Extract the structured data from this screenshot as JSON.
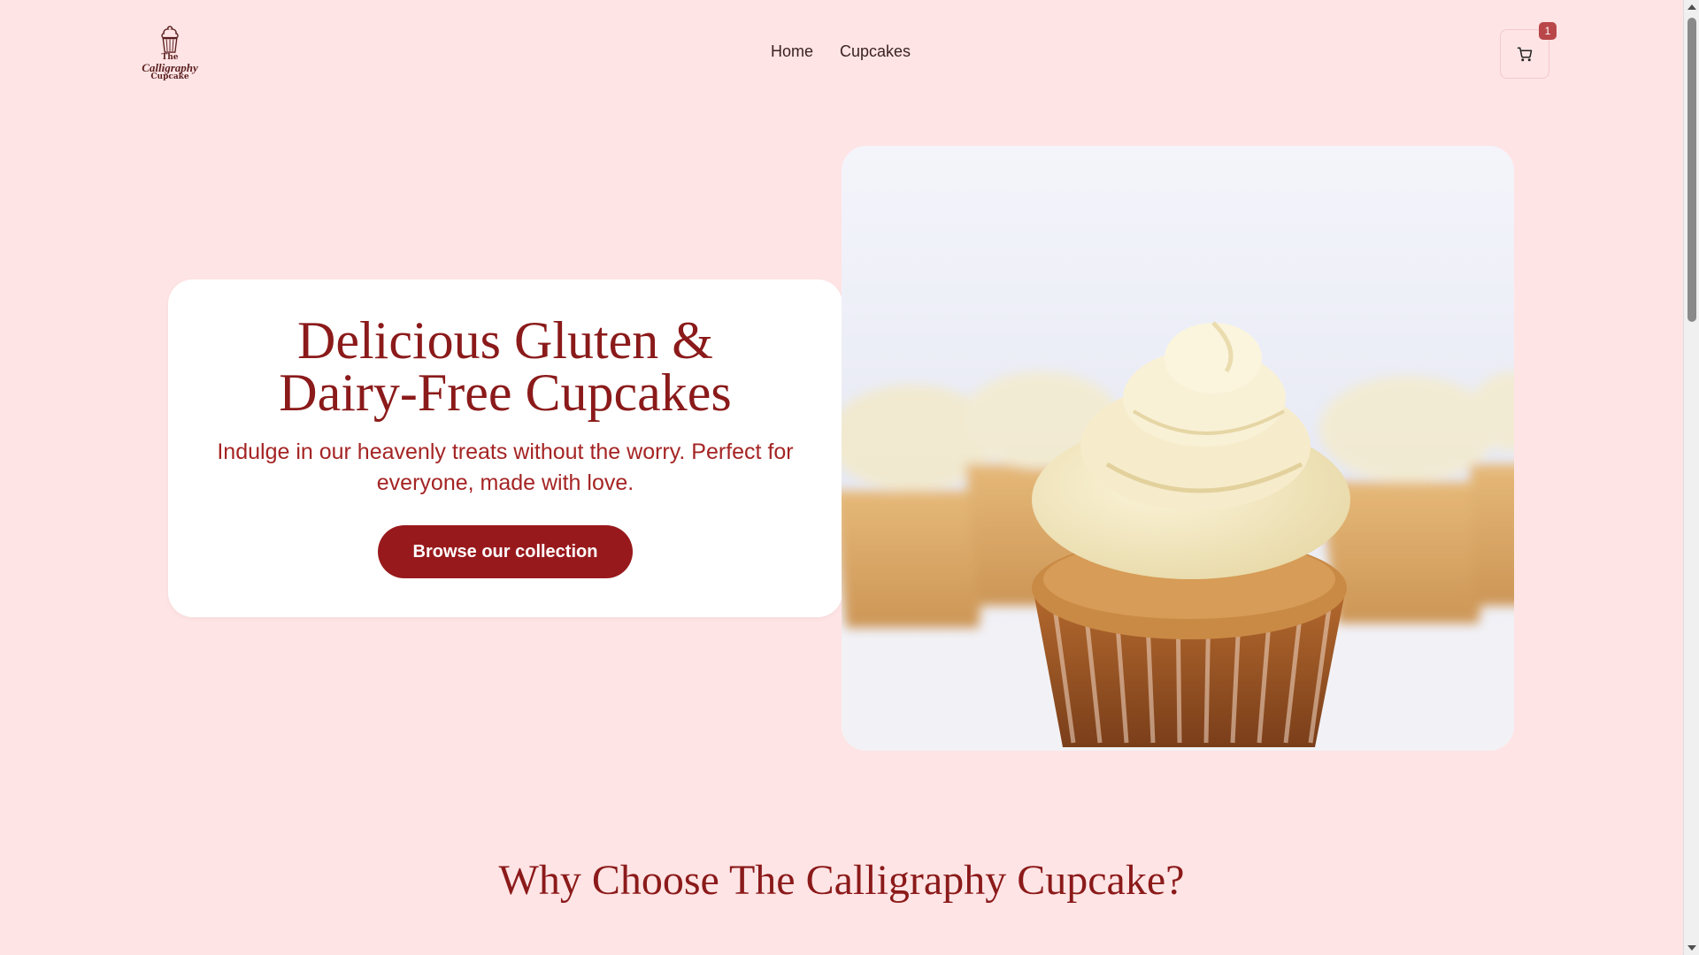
{
  "header": {
    "logo": {
      "line1": "The",
      "line2": "Calligraphy",
      "line3": "Cupcake"
    },
    "nav": [
      {
        "label": "Home"
      },
      {
        "label": "Cupcakes"
      }
    ],
    "cart": {
      "icon": "cart-icon",
      "count": "1"
    }
  },
  "hero": {
    "title": "Delicious Gluten & Dairy-Free Cupcakes",
    "subtitle": "Indulge in our heavenly treats without the worry. Perfect for everyone, made with love.",
    "cta_label": "Browse our collection",
    "image_subject": "cupcakes-photo"
  },
  "why": {
    "title": "Why Choose The Calligraphy Cupcake?"
  },
  "colors": {
    "background": "#ffe4e5",
    "accent": "#98191c",
    "text": "#8b1a1a",
    "badge": "#b9474a"
  }
}
